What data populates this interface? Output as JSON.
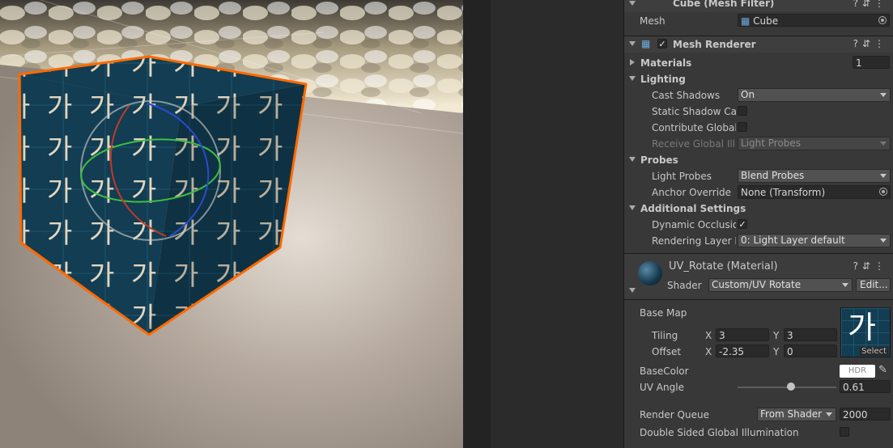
{
  "mesh_filter": {
    "title": "Cube (Mesh Filter)",
    "mesh_label": "Mesh",
    "mesh_value": "Cube"
  },
  "mesh_renderer": {
    "title": "Mesh Renderer",
    "materials_label": "Materials",
    "materials_count": "1",
    "lighting_label": "Lighting",
    "cast_shadows_label": "Cast Shadows",
    "cast_shadows_value": "On",
    "static_shadow_label": "Static Shadow Caster",
    "contribute_gi_label": "Contribute Global Illumination",
    "receive_gi_label": "Receive Global Illumination",
    "receive_gi_value": "Light Probes",
    "probes_label": "Probes",
    "light_probes_label": "Light Probes",
    "light_probes_value": "Blend Probes",
    "anchor_override_label": "Anchor Override",
    "anchor_override_value": "None (Transform)",
    "additional_settings_label": "Additional Settings",
    "dynamic_occlusion_label": "Dynamic Occlusion",
    "rendering_layer_label": "Rendering Layer Mask",
    "rendering_layer_value": "0: Light Layer default"
  },
  "material": {
    "title": "UV_Rotate (Material)",
    "shader_label": "Shader",
    "shader_value": "Custom/UV Rotate",
    "edit_label": "Edit...",
    "base_map_label": "Base Map",
    "tiling_label": "Tiling",
    "tiling_x": "3",
    "tiling_y": "3",
    "offset_label": "Offset",
    "offset_x": "-2.35",
    "offset_y": "0",
    "x_label": "X",
    "y_label": "Y",
    "texture_glyph": "가",
    "select_label": "Select",
    "base_color_label": "BaseColor",
    "hdr_label": "HDR",
    "uv_angle_label": "UV Angle",
    "uv_angle_value": "0.61",
    "uv_angle_fraction": 0.54,
    "render_queue_label": "Render Queue",
    "render_queue_mode": "From Shader",
    "render_queue_value": "2000",
    "double_sided_gi_label": "Double Sided Global Illumination"
  },
  "scene": {
    "cube_glyph": "가"
  },
  "colors": {
    "selection_outline": "#ff6a00",
    "texture_bg": "#0f3a4f",
    "checkmark": "#e8e8e8"
  }
}
